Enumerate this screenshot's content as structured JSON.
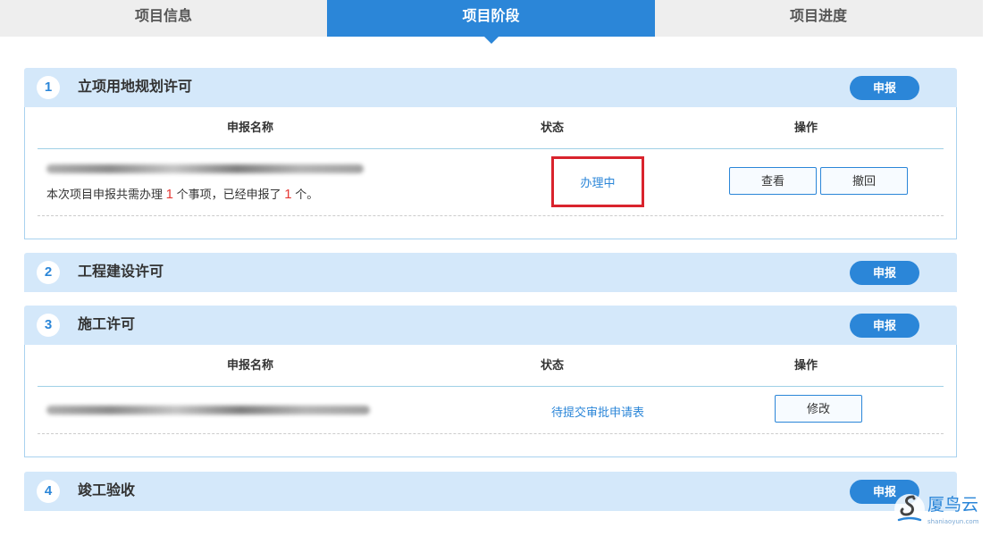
{
  "tabs": [
    {
      "label": "项目信息",
      "active": false
    },
    {
      "label": "项目阶段",
      "active": true
    },
    {
      "label": "项目进度",
      "active": false
    }
  ],
  "table_headers": {
    "name": "申报名称",
    "status": "状态",
    "action": "操作"
  },
  "sections": [
    {
      "num": "1",
      "title": "立项用地规划许可",
      "button": "申报",
      "row": {
        "note_prefix": "本次项目申报共需办理",
        "note_total": "1",
        "note_mid": "个事项，已经申报了",
        "note_done": "1",
        "note_suffix": "个。",
        "status": "办理中",
        "actions": [
          "查看",
          "撤回"
        ]
      }
    },
    {
      "num": "2",
      "title": "工程建设许可",
      "button": "申报"
    },
    {
      "num": "3",
      "title": "施工许可",
      "button": "申报",
      "row": {
        "status": "待提交审批申请表",
        "actions": [
          "修改"
        ]
      }
    },
    {
      "num": "4",
      "title": "竣工验收",
      "button": "申报"
    }
  ],
  "watermark": {
    "brand": "厦鸟云",
    "site": "shaniaoyun.com"
  },
  "colors": {
    "accent": "#2b86d8",
    "section_header": "#d4e8fa",
    "highlight": "#d9232d",
    "count_red": "#e53935"
  }
}
